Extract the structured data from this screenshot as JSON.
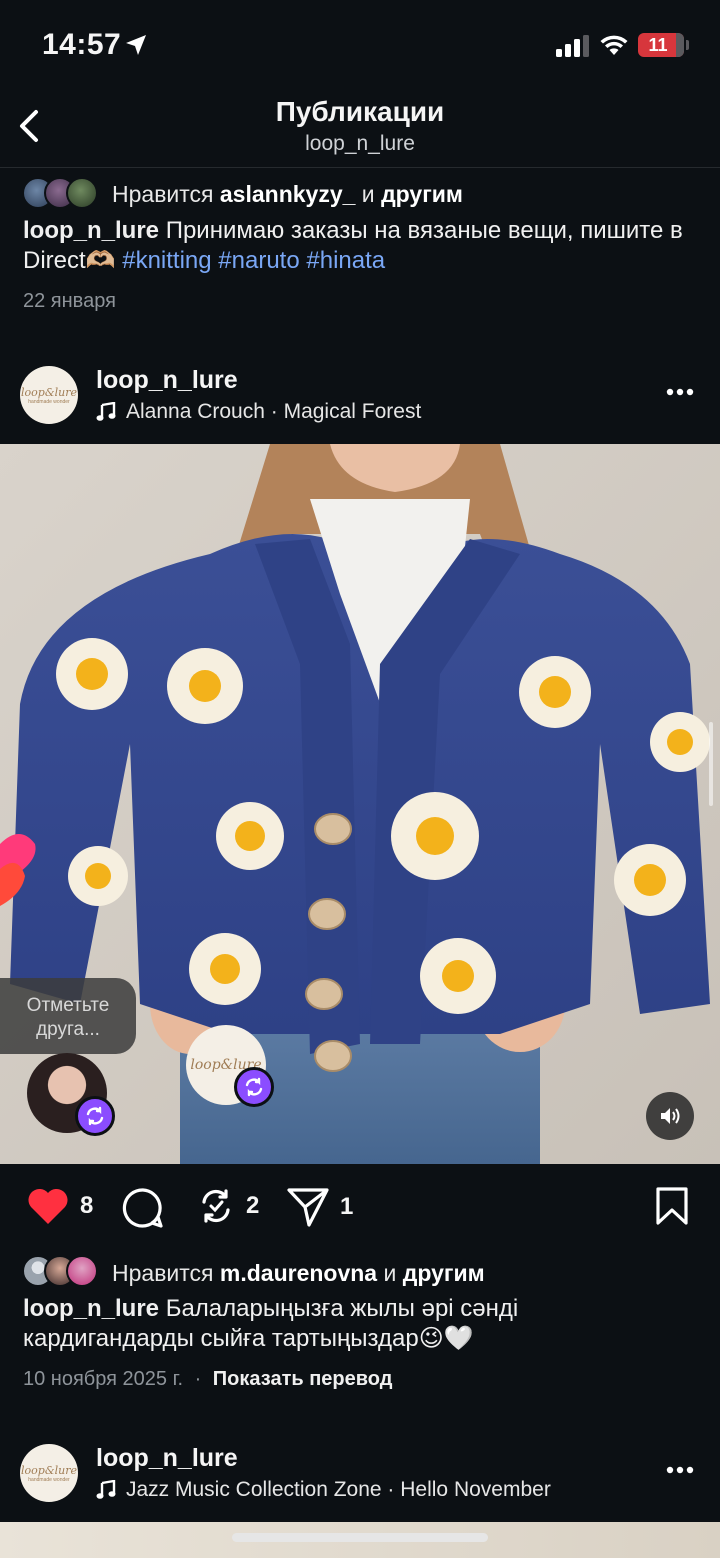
{
  "status_bar": {
    "time": "14:57",
    "battery": "11"
  },
  "nav": {
    "title": "Публикации",
    "subtitle": "loop_n_lure"
  },
  "post1": {
    "likes_prefix": "Нравится ",
    "likes_user": "aslannkyzy_",
    "likes_mid": " и ",
    "likes_suffix": "другим",
    "author": "loop_n_lure",
    "caption_text": " Принимаю заказы на вязаные вещи, пишите в Direct🫶🏼 ",
    "hashtags": [
      "#knitting",
      "#naruto",
      "#hinata"
    ],
    "date": "22 января"
  },
  "post2": {
    "user": "loop_n_lure",
    "music": "Alanna Crouch · Magical Forest",
    "avatar_logo": "loop&lure",
    "avatar_logo_sub": "handmade wonder",
    "tag_friend": "Отметьте друга...",
    "like_count": "8",
    "repost_count": "2",
    "share_count": "1",
    "likes_prefix": "Нравится ",
    "likes_user": "m.daurenovna",
    "likes_mid": " и ",
    "likes_suffix": "другим",
    "author": "loop_n_lure",
    "caption_text": " Балаларыңызға жылы әрі сәнді кардигандарды сыйға тартыңыздар😉🤍",
    "date": "10 ноября 2025 г.",
    "separator": "·",
    "translate": "Показать перевод"
  },
  "post3": {
    "user": "loop_n_lure",
    "music": "Jazz Music Collection Zone · Hello November"
  },
  "colors": {
    "like_red": "#ff3040",
    "tag_blue": "#7aa7f5",
    "repost_purple": "#8b4dff",
    "cardigan": "#34498f"
  }
}
